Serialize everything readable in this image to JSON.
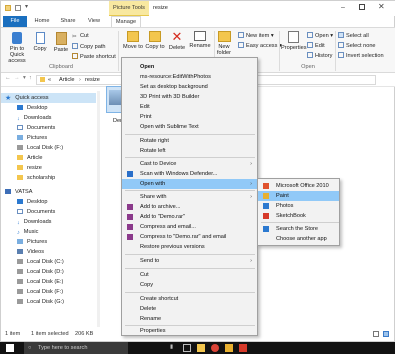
{
  "window": {
    "title": "resize",
    "context_tab": "Picture Tools"
  },
  "tabs": [
    "File",
    "Home",
    "Share",
    "View",
    "Manage"
  ],
  "ribbon": {
    "pin_label": "Pin to Quick access",
    "copy_label": "Copy",
    "paste_label": "Paste",
    "cut_label": "Cut",
    "copy_path_label": "Copy path",
    "paste_shortcut_label": "Paste shortcut",
    "move_to_label": "Move to",
    "copy_to_label": "Copy to",
    "delete_label": "Delete",
    "rename_label": "Rename",
    "new_folder_label": "New folder",
    "new_item_label": "New item",
    "easy_access_label": "Easy access",
    "properties_label": "Properties",
    "open_label": "Open",
    "edit_label": "Edit",
    "history_label": "History",
    "select_all_label": "Select all",
    "select_none_label": "Select none",
    "invert_selection_label": "Invert selection",
    "groups": {
      "clipboard": "Clipboard",
      "open": "Open"
    }
  },
  "address": {
    "path_root": "«",
    "path_1": "Article",
    "path_2": "resize"
  },
  "nav": {
    "items": [
      "Quick access",
      "Desktop",
      "Downloads",
      "Documents",
      "Pictures",
      "Local Disk (F:)",
      "Article",
      "resize",
      "scholarship",
      "VATSA",
      "Desktop",
      "Documents",
      "Downloads",
      "Music",
      "Pictures",
      "Videos",
      "Local Disk (C:)",
      "Local Disk (D:)",
      "Local Disk (E:)",
      "Local Disk (F:)",
      "Local Disk (G:)"
    ]
  },
  "file": {
    "label": "Demo"
  },
  "status": {
    "count": "1 item",
    "selected": "1 item selected",
    "size": "206 KB"
  },
  "context_menu": {
    "items": [
      "Open",
      "ms-resource:EditWithPhotos",
      "Set as desktop background",
      "3D Print with 3D Builder",
      "Edit",
      "Print",
      "Open with Sublime Text",
      "Rotate right",
      "Rotate left",
      "Cast to Device",
      "Scan with Windows Defender...",
      "Open with",
      "Share with",
      "Add to archive...",
      "Add to \"Demo.rar\"",
      "Compress and email...",
      "Compress to \"Demo.rar\" and email",
      "Restore previous versions",
      "Send to",
      "Cut",
      "Copy",
      "Create shortcut",
      "Delete",
      "Rename",
      "Properties"
    ]
  },
  "submenu": {
    "items": [
      "Microsoft Office 2010",
      "Paint",
      "Photos",
      "SketchBook",
      "Search the Store",
      "Choose another app"
    ]
  },
  "taskbar": {
    "search_placeholder": "Type here to search"
  },
  "colors": {
    "accent": "#1a6fbf",
    "context_tab": "#f8e8a0",
    "highlight": "#91c9f7",
    "selection": "#cce4f7"
  }
}
